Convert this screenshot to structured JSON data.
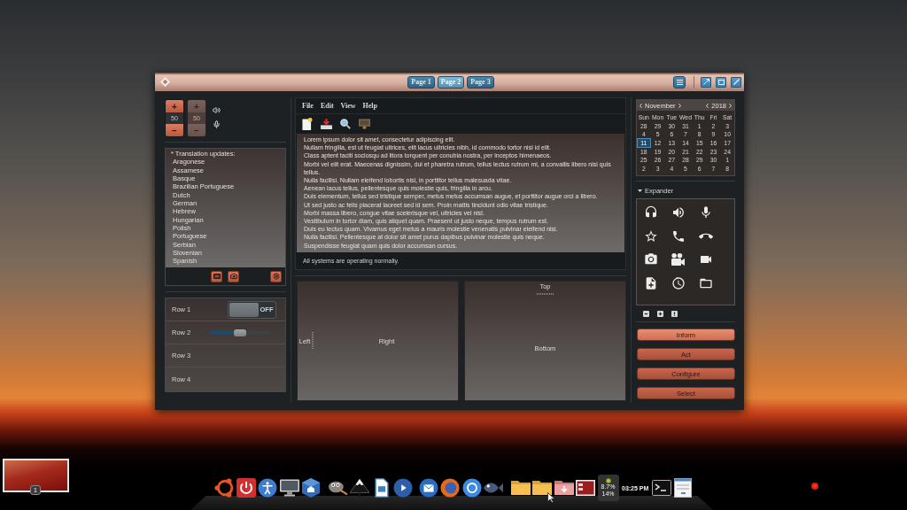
{
  "window": {
    "tabs": [
      {
        "label": "Page 1",
        "selected": false
      },
      {
        "label": "Page 2",
        "selected": true
      },
      {
        "label": "Page 3",
        "selected": false
      }
    ]
  },
  "volume_controls": [
    {
      "increment": "+",
      "value": "50",
      "decrement": "−",
      "disabled": false
    },
    {
      "increment": "+",
      "value": "50",
      "decrement": "−",
      "disabled": true
    }
  ],
  "translation_list": {
    "header": "* Translation updates:",
    "items": [
      "Aragonese",
      "Assamese",
      "Basque",
      "Brazilian Portuguese",
      "Dutch",
      "German",
      "Hebrew",
      "Hungarian",
      "Polish",
      "Portuguese",
      "Serbian",
      "Slovenian",
      "Spanish"
    ]
  },
  "settings_rows": [
    {
      "label": "Row 1",
      "kind": "switch",
      "on": false,
      "state_text": "OFF"
    },
    {
      "label": "Row 2",
      "kind": "slider",
      "level": 0.5
    },
    {
      "label": "Row 3",
      "kind": "plain"
    },
    {
      "label": "Row 4",
      "kind": "plain"
    }
  ],
  "menubar": [
    "File",
    "Edit",
    "View",
    "Help"
  ],
  "text_view": {
    "lines": [
      "Lorem ipsum dolor sit amet, consectetur adipiscing elit.",
      "Nullam fringilla, est ut feugiat ultrices, elit lacus ultricies nibh, id commodo tortor nisi id elit.",
      "Class aptent taciti sociosqu ad litora torquent per conubia nostra, per inceptos himenaeos.",
      "Morbi vel elit erat. Maecenas dignissim, dui et pharetra rutrum, tellus lectus rutrum mi, a convallis libero nisi quis tellus.",
      "Nulla facilisi. Nullam eleifend lobortis nisl, in porttitor tellus malesuada vitae.",
      "Aenean lacus tellus, pellentesque quis molestie quis, fringilla in arcu.",
      "Duis elementum, tellus sed tristique semper, metus metus accumsan augue, et porttitor augue orci a libero.",
      "Ut sed justo ac felis placerat laoreet sed id sem. Proin mattis tincidunt odio vitae tristique.",
      "Morbi massa libero, congue vitae scelerisque vel, ultricies vel nisl.",
      "Vestibulum in tortor diam, quis aliquet quam. Praesent ut justo neque, tempus rutrum est.",
      "Duis eu lectus quam. Vivamus eget metus a mauris molestie venenatis pulvinar eleifend nisi.",
      "Nulla facilisi. Pellentesque at dolor sit amet purus dapibus pulvinar molestie quis neque.",
      "Suspendisse feugiat quam quis dolor accumsan cursus."
    ]
  },
  "status_bar": {
    "message": "All systems are operating normally."
  },
  "panes": [
    {
      "kind": "horizontal",
      "first": "Left",
      "second": "Right"
    },
    {
      "kind": "vertical",
      "first": "Top",
      "second": "Bottom"
    }
  ],
  "calendar": {
    "month": "November",
    "year": "2018",
    "weekdays": [
      "Sun",
      "Mon",
      "Tue",
      "Wed",
      "Thu",
      "Fri",
      "Sat"
    ],
    "weeks": [
      [
        {
          "day": "28",
          "selected": false
        },
        {
          "day": "29",
          "selected": false
        },
        {
          "day": "30",
          "selected": false
        },
        {
          "day": "31",
          "selected": false
        },
        {
          "day": "1",
          "selected": false
        },
        {
          "day": "2",
          "selected": false
        },
        {
          "day": "3",
          "selected": false
        }
      ],
      [
        {
          "day": "4",
          "selected": false
        },
        {
          "day": "5",
          "selected": false
        },
        {
          "day": "6",
          "selected": false
        },
        {
          "day": "7",
          "selected": false
        },
        {
          "day": "8",
          "selected": false
        },
        {
          "day": "9",
          "selected": false
        },
        {
          "day": "10",
          "selected": false
        }
      ],
      [
        {
          "day": "11",
          "selected": true
        },
        {
          "day": "12",
          "selected": false
        },
        {
          "day": "13",
          "selected": false
        },
        {
          "day": "14",
          "selected": false
        },
        {
          "day": "15",
          "selected": false
        },
        {
          "day": "16",
          "selected": false
        },
        {
          "day": "17",
          "selected": false
        }
      ],
      [
        {
          "day": "18",
          "selected": false
        },
        {
          "day": "19",
          "selected": false
        },
        {
          "day": "20",
          "selected": false
        },
        {
          "day": "21",
          "selected": false
        },
        {
          "day": "22",
          "selected": false
        },
        {
          "day": "23",
          "selected": false
        },
        {
          "day": "24",
          "selected": false
        }
      ],
      [
        {
          "day": "25",
          "selected": false
        },
        {
          "day": "26",
          "selected": false
        },
        {
          "day": "27",
          "selected": false
        },
        {
          "day": "28",
          "selected": false
        },
        {
          "day": "29",
          "selected": false
        },
        {
          "day": "30",
          "selected": false
        },
        {
          "day": "1",
          "selected": false
        }
      ],
      [
        {
          "day": "2",
          "selected": false
        },
        {
          "day": "3",
          "selected": false
        },
        {
          "day": "4",
          "selected": false
        },
        {
          "day": "5",
          "selected": false
        },
        {
          "day": "6",
          "selected": false
        },
        {
          "day": "7",
          "selected": false
        },
        {
          "day": "8",
          "selected": false
        }
      ]
    ]
  },
  "expander": {
    "label": "Expander",
    "expanded": true
  },
  "buttons": [
    {
      "label": "Inform",
      "focused": true
    },
    {
      "label": "Act",
      "focused": false
    },
    {
      "label": "Configure",
      "focused": false
    },
    {
      "label": "Select",
      "focused": false
    }
  ],
  "dock": {
    "cpu_usage": "8.7%",
    "memory_usage": "14%",
    "clock": "03:25 PM"
  },
  "workspace_switcher": {
    "number": "1"
  }
}
